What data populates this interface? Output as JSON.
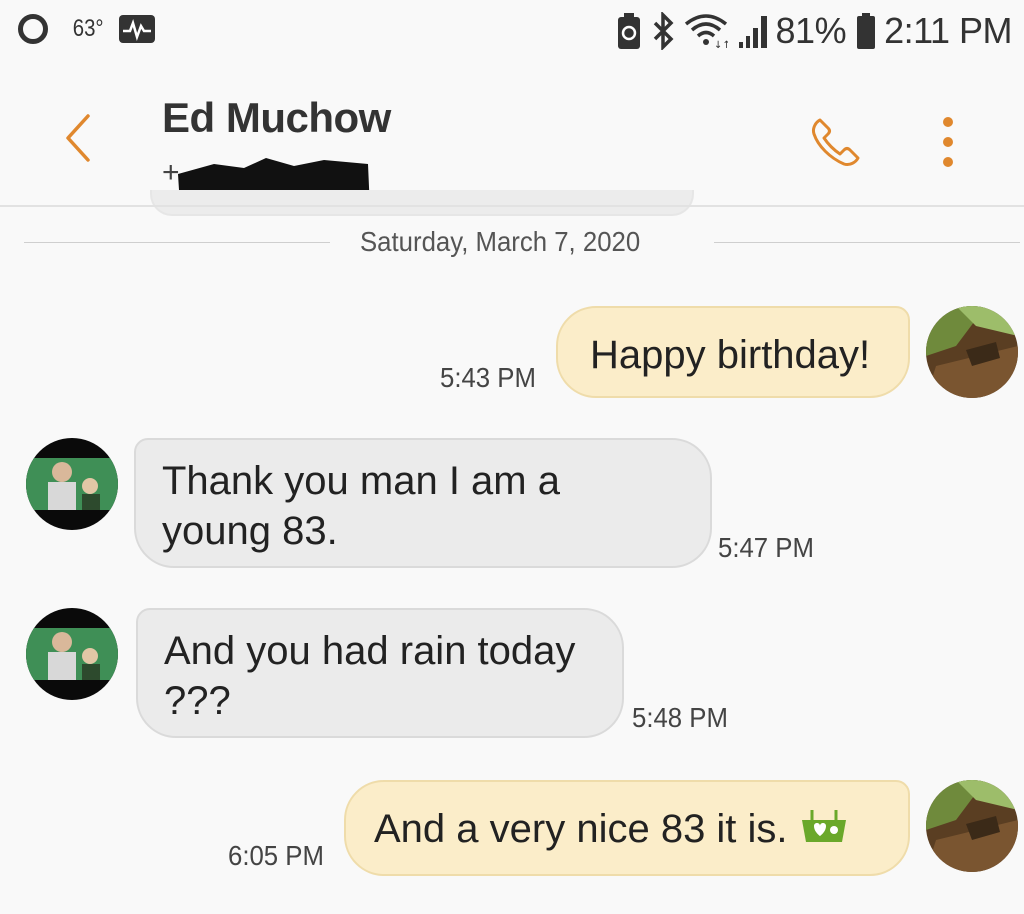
{
  "status_bar": {
    "temperature": "63°",
    "battery_percent": "81%",
    "time": "2:11 PM",
    "icons": [
      "circle-icon",
      "pulse-icon",
      "battery-saver-icon",
      "bluetooth-icon",
      "wifi-icon",
      "signal-icon",
      "battery-icon"
    ]
  },
  "header": {
    "contact_name": "Ed Muchow",
    "contact_number_prefix": "+"
  },
  "conversation": {
    "date_separator": "Saturday, March 7, 2020",
    "messages": [
      {
        "direction": "outgoing",
        "text": "Happy birthday!",
        "time": "5:43 PM"
      },
      {
        "direction": "incoming",
        "text_line1": "Thank you man I am a",
        "text_line2": "young 83.",
        "time": "5:47 PM"
      },
      {
        "direction": "incoming",
        "text_line1": "And you had rain today",
        "text_line2": "???",
        "time": "5:48 PM"
      },
      {
        "direction": "outgoing",
        "text": "And a very nice 83 it is.",
        "emoji": "cake-emoji-icon",
        "time": "6:05 PM"
      }
    ]
  },
  "colors": {
    "accent": "#e0882e",
    "outgoing_bubble": "#fbedc9",
    "incoming_bubble": "#ebebeb",
    "background": "#f9f9f9"
  }
}
